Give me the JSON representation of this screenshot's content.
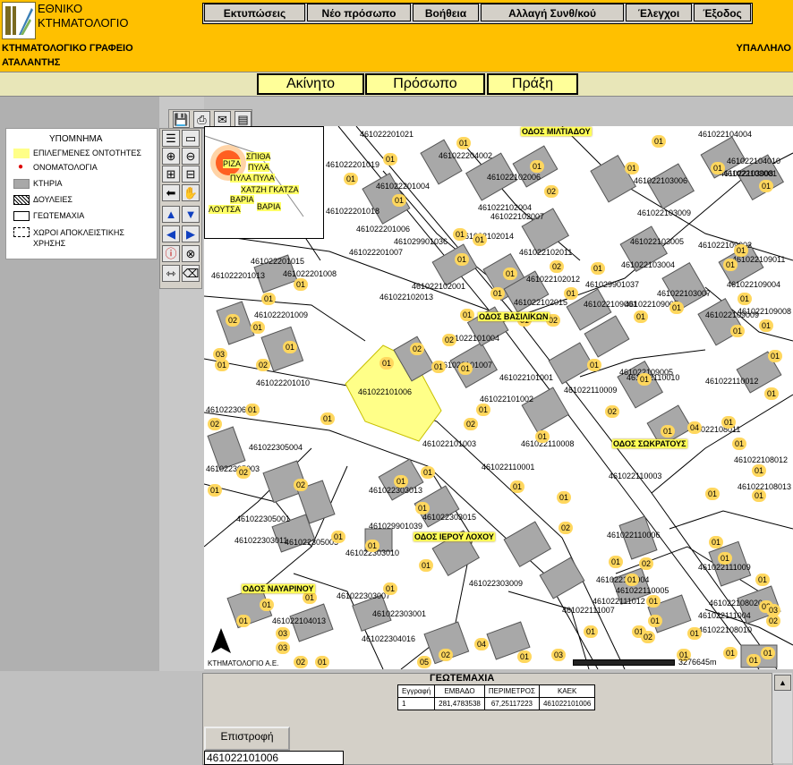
{
  "logo": {
    "line1": "ΕΘΝΙΚΟ",
    "line2": "ΚΤΗΜΑΤΟΛΟΓΙΟ"
  },
  "menu": [
    "Εκτυπώσεις",
    "Νέο πρόσωπο",
    "Βοήθεια",
    "Αλλαγή Συνθ/κού",
    "Έλεγχοι",
    "Έξοδος"
  ],
  "office": {
    "line1": "ΚΤΗΜΑΤΟΛΟΓΙΚΟ ΓΡΑΦΕΙΟ",
    "line2": "ΑΤΑΛΑΝΤΗΣ"
  },
  "user_label": "ΥΠΑΛΛΗΛΟ",
  "tabs": [
    "Ακίνητο",
    "Πρόσωπο",
    "Πράξη"
  ],
  "legend": {
    "title": "ΥΠΟΜΝΗΜΑ",
    "items": [
      "ΕΠΙΛΕΓΜΕΝΕΣ ΟΝΤΟΤΗΤΕΣ",
      "ΟΝΟΜΑΤΟΛΟΓΙΑ",
      "ΚΤΗΡΙΑ",
      "ΔΟΥΛΕΙΕΣ",
      "ΓΕΩΤΕΜΑΧΙΑ",
      "ΧΩΡΟΙ ΑΠΟΚΛΕΙΣΤΙΚΗΣ ΧΡΗΣΗΣ"
    ]
  },
  "overview_labels": [
    "ΡΙΖΑ",
    "ΣΠΙΘΑ",
    "ΠΥΛΑ",
    "ΠΥΛΑ ΠΥΛΑ",
    "ΧΑΤΖΗ ΓΚΑΤΖΑ",
    "ΒΑΡΙΑ",
    "ΛΟΥΤΣΑ",
    "ΒΑΡΙΑ"
  ],
  "streets": [
    "ΟΔΟΣ ΜΙΛΤΙΑΔΟΥ",
    "ΟΔΟΣ ΒΑΣΙΛΙΚΩΝ",
    "ΟΔΟΣ ΣΩΚΡΑΤΟΥΣ",
    "ΟΔΟΣ ΙΕΡΟΥ ΛΟΧΟΥ",
    "ΟΔΟΣ ΝΑΥΑΡΙΝΟΥ"
  ],
  "parcel_numbers": [
    "461022201021",
    "461022201019",
    "461022204002",
    "461022201004",
    "461022201018",
    "461022201006",
    "461022201007",
    "461029901036",
    "461022102014",
    "461022102006",
    "461022102004",
    "461022102007",
    "461022102011",
    "461022102012",
    "461022102013",
    "461022102001",
    "461022102015",
    "461022201015",
    "461022201013",
    "461022201008",
    "461022201009",
    "461022201010",
    "461022101004",
    "461022101007",
    "461022101006",
    "461022101001",
    "461022101002",
    "461022101003",
    "461022306001",
    "461022305004",
    "461022305003",
    "461022303013",
    "461022305001",
    "461022305005",
    "461029901039",
    "461022303011",
    "461022303015",
    "461022303010",
    "461022303009",
    "461022303007",
    "461022303001",
    "461022304016",
    "461022104013",
    "461022104004",
    "461022104010",
    "461022103008",
    "461022103001",
    "461022103006",
    "461022103009",
    "461022103005",
    "461022103004",
    "461029901037",
    "461022103007",
    "461022109007",
    "461022109001",
    "461022109002",
    "461022109011",
    "461022109004",
    "461022109008",
    "461022109009",
    "461022109005",
    "461022110010",
    "461022110012",
    "461022110009",
    "461022110008",
    "461022110001",
    "461022110003",
    "461022110006",
    "461022110004",
    "461022110005",
    "461022111012",
    "461022111007",
    "461022111009",
    "461022111004",
    "461022108020",
    "461022108010",
    "461022108011",
    "461022108012",
    "461022108013"
  ],
  "badges": [
    "01",
    "02",
    "03",
    "04",
    "05"
  ],
  "copyright": "ΚΤΗΜΑΤΟΛΟΓΙΟ Α.Ε.",
  "scale_text": "3276645m",
  "info": {
    "title": "ΓΕΩΤΕΜΑΧΙΑ",
    "headers": [
      "Εγγραφή",
      "ΕΜΒΑΔΟ",
      "ΠΕΡΙΜΕΤΡΟΣ",
      "ΚΑΕΚ"
    ],
    "row": [
      "1",
      "281,4783538",
      "67,25117223",
      "461022101006"
    ]
  },
  "return_label": "Επιστροφή",
  "kaek_value": "461022101006",
  "colors": {
    "header": "#ffc000",
    "selection": "#ffff88",
    "building": "#a8a8a8",
    "badge": "#ffd75e"
  }
}
